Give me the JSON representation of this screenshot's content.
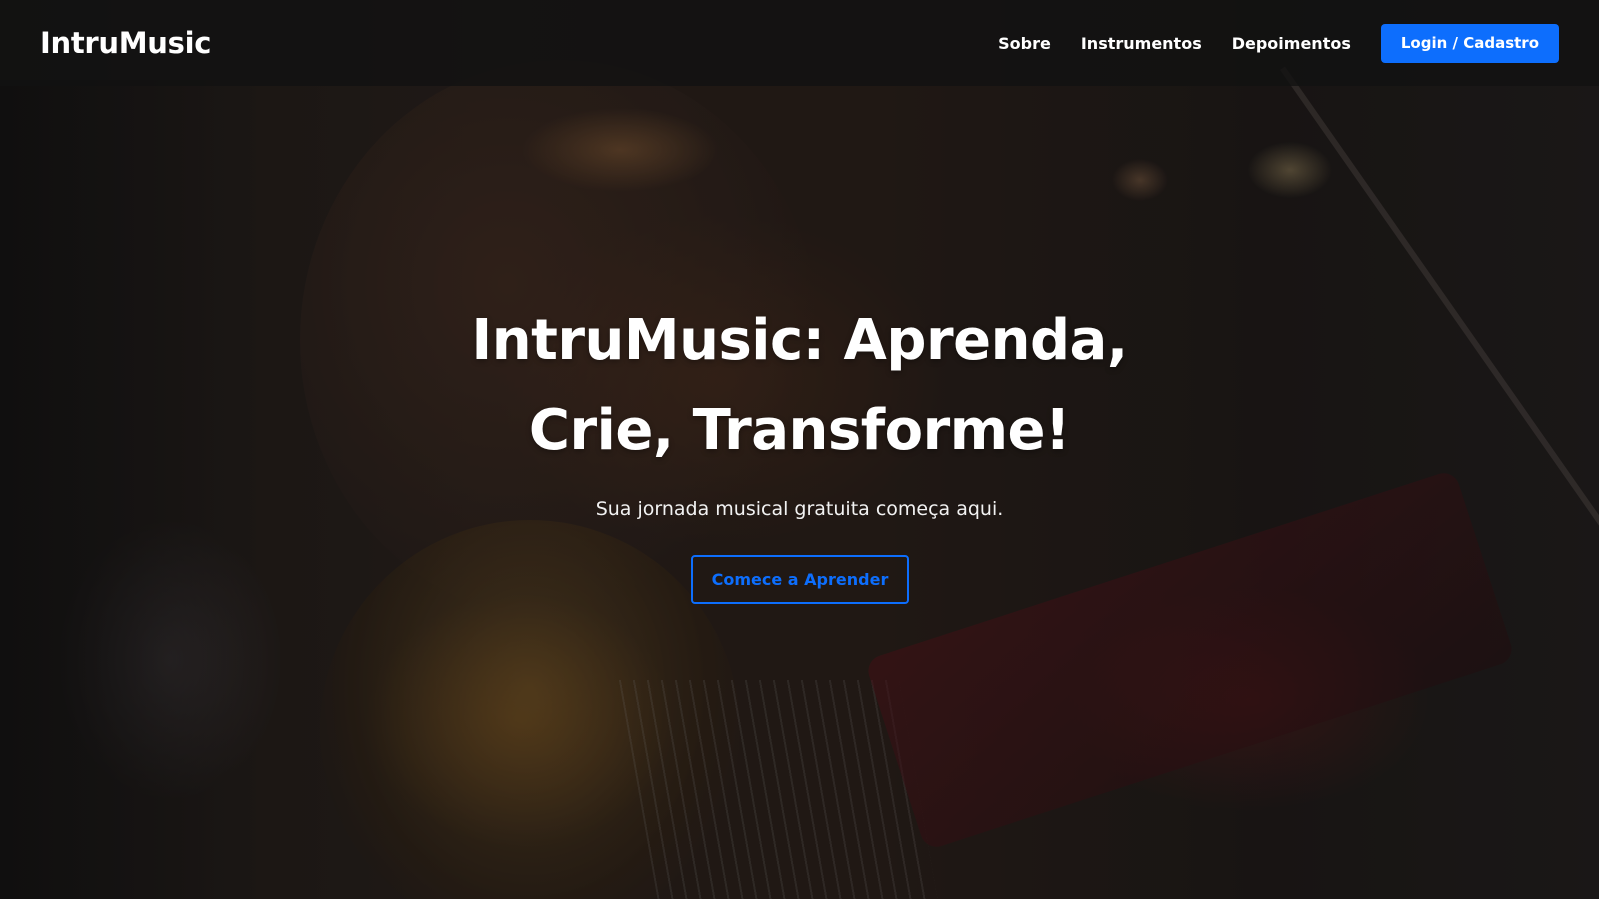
{
  "header": {
    "logo": "IntruMusic",
    "nav": {
      "about": "Sobre",
      "instruments": "Instrumentos",
      "testimonials": "Depoimentos"
    },
    "login_label": "Login / Cadastro"
  },
  "hero": {
    "title_line1": "IntruMusic: Aprenda,",
    "title_line2": "Crie, Transforme!",
    "subtitle": "Sua jornada musical gratuita começa aqui.",
    "cta_label": "Comece a Aprender"
  },
  "colors": {
    "accent": "#0d6efd",
    "header_bg": "#121212",
    "text": "#ffffff"
  }
}
